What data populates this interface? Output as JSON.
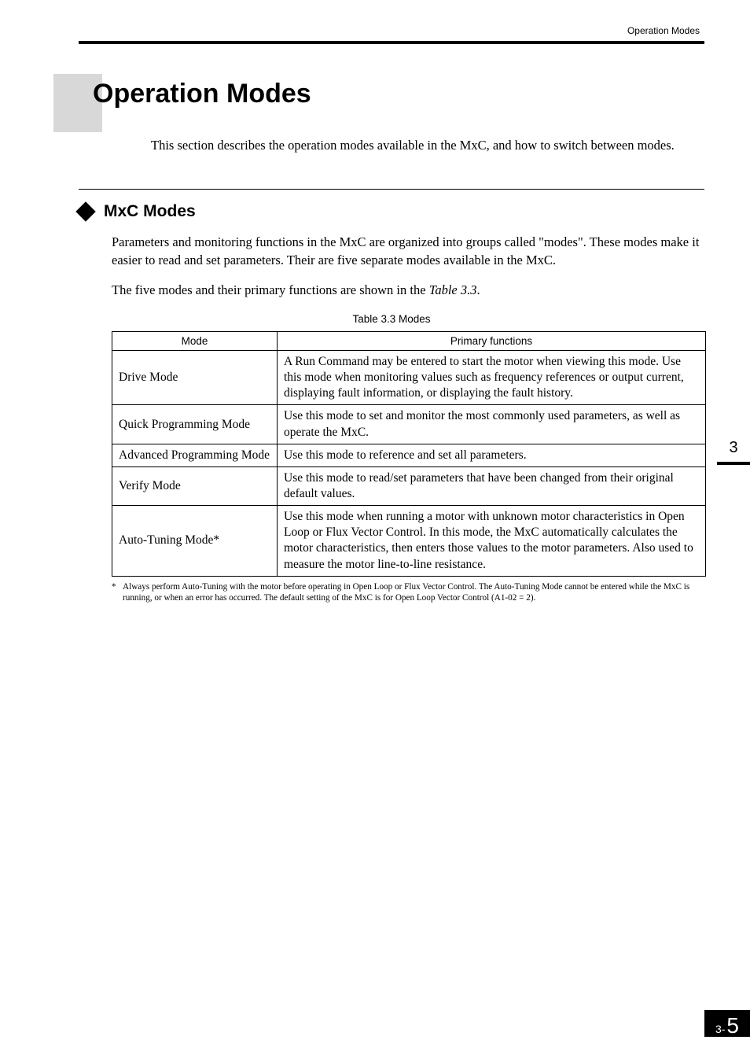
{
  "header": {
    "section_label": "Operation Modes"
  },
  "title": "Operation Modes",
  "intro": "This section describes the operation modes available in the MxC, and how to switch between modes.",
  "section": {
    "heading": "MxC Modes",
    "p1": "Parameters and monitoring functions in the MxC are organized into groups called \"modes\". These modes make it easier to read and set parameters. Their are five separate modes available in the MxC.",
    "p2_pre": "The five modes and their primary functions are shown in the ",
    "p2_em": "Table 3.3",
    "p2_post": "."
  },
  "table": {
    "caption": "Table 3.3  Modes",
    "head_mode": "Mode",
    "head_func": "Primary functions",
    "rows": [
      {
        "mode": "Drive Mode",
        "func": "A Run Command may be entered to start the motor when viewing this mode. Use this mode when monitoring values such as frequency references or output current, displaying fault information, or displaying the fault history."
      },
      {
        "mode": "Quick Programming Mode",
        "func": "Use this mode to set and monitor the most commonly used parameters, as well as operate the MxC."
      },
      {
        "mode": "Advanced Programming Mode",
        "func": "Use this mode to reference and set all parameters."
      },
      {
        "mode": "Verify Mode",
        "func": "Use this mode to read/set parameters that have been changed from their original default values."
      },
      {
        "mode": "Auto-Tuning Mode*",
        "func": "Use this mode when running a motor with unknown motor characteristics in Open Loop or Flux Vector Control. In this mode, the MxC automatically calculates the motor characteristics, then enters those values to the motor parameters. Also used to measure the motor line-to-line resistance."
      }
    ]
  },
  "footnote": {
    "marker": "*",
    "text": "Always perform Auto-Tuning with the motor before operating in Open Loop or Flux Vector Control. The Auto-Tuning Mode cannot be entered while the MxC is running, or when an error has occurred. The default setting of the MxC is for Open Loop Vector Control (A1-02 = 2)."
  },
  "side": {
    "chapter": "3"
  },
  "footer": {
    "prefix": "3-",
    "page": "5"
  }
}
